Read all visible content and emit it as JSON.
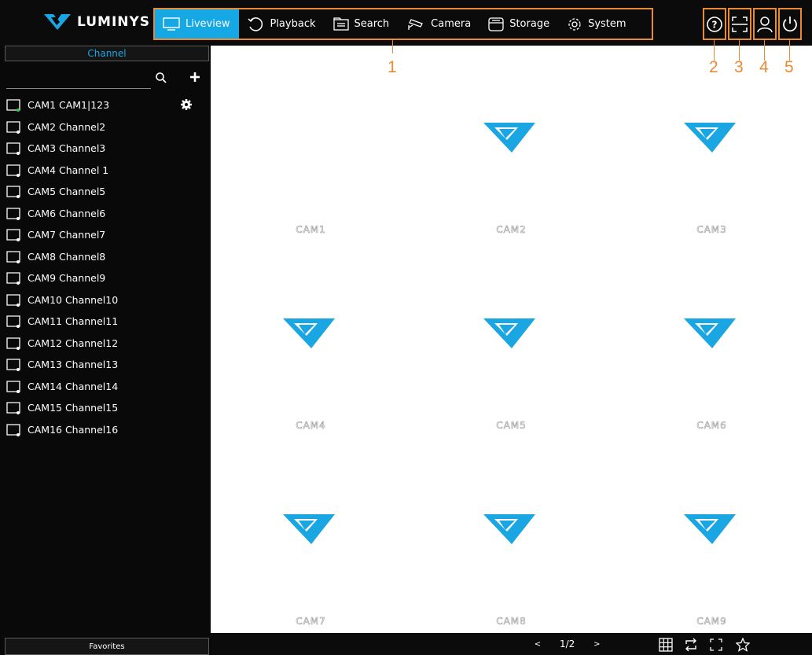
{
  "brand": {
    "name": "LUMINYS",
    "color": "#19a6e3"
  },
  "nav": {
    "items": [
      {
        "label": "Liveview",
        "icon": "monitor-icon",
        "active": true
      },
      {
        "label": "Playback",
        "icon": "playback-icon",
        "active": false
      },
      {
        "label": "Search",
        "icon": "search-folder-icon",
        "active": false
      },
      {
        "label": "Camera",
        "icon": "camera-icon",
        "active": false
      },
      {
        "label": "Storage",
        "icon": "storage-icon",
        "active": false
      },
      {
        "label": "System",
        "icon": "gear-icon",
        "active": false
      }
    ]
  },
  "header_icons": [
    {
      "icon": "help-icon"
    },
    {
      "icon": "scan-icon"
    },
    {
      "icon": "user-icon"
    },
    {
      "icon": "power-icon"
    }
  ],
  "annotations": {
    "nav": "1",
    "help": "2",
    "scan": "3",
    "user": "4",
    "power": "5",
    "color": "#e98a34"
  },
  "sidebar": {
    "channel_header": "Channel",
    "search_value": "",
    "channels": [
      {
        "label": "CAM1 CAM1|123",
        "online": true
      },
      {
        "label": "CAM2 Channel2",
        "online": false
      },
      {
        "label": "CAM3 Channel3",
        "online": false
      },
      {
        "label": "CAM4 Channel 1",
        "online": false
      },
      {
        "label": "CAM5 Channel5",
        "online": false
      },
      {
        "label": "CAM6 Channel6",
        "online": false
      },
      {
        "label": "CAM7 Channel7",
        "online": false
      },
      {
        "label": "CAM8 Channel8",
        "online": false
      },
      {
        "label": "CAM9 Channel9",
        "online": false
      },
      {
        "label": "CAM10 Channel10",
        "online": false
      },
      {
        "label": "CAM11 Channel11",
        "online": false
      },
      {
        "label": "CAM12 Channel12",
        "online": false
      },
      {
        "label": "CAM13 Channel13",
        "online": false
      },
      {
        "label": "CAM14 Channel14",
        "online": false
      },
      {
        "label": "CAM15 Channel15",
        "online": false
      },
      {
        "label": "CAM16 Channel16",
        "online": false
      }
    ],
    "favorites_label": "Favorites"
  },
  "grid": {
    "cells": [
      {
        "name": "CAM1",
        "show_logo": false
      },
      {
        "name": "CAM2",
        "show_logo": true
      },
      {
        "name": "CAM3",
        "show_logo": true
      },
      {
        "name": "CAM4",
        "show_logo": true
      },
      {
        "name": "CAM5",
        "show_logo": true
      },
      {
        "name": "CAM6",
        "show_logo": true
      },
      {
        "name": "CAM7",
        "show_logo": true
      },
      {
        "name": "CAM8",
        "show_logo": true
      },
      {
        "name": "CAM9",
        "show_logo": true
      }
    ]
  },
  "pager": {
    "prev": "<",
    "current": "1/2",
    "next": ">"
  },
  "bottom_icons": [
    "layout-grid-icon",
    "cycle-icon",
    "fullscreen-icon",
    "favorite-star-icon"
  ],
  "colors": {
    "accent": "#16a8e4",
    "online": "#2ecc40",
    "background_dark": "#0b0b0b"
  }
}
